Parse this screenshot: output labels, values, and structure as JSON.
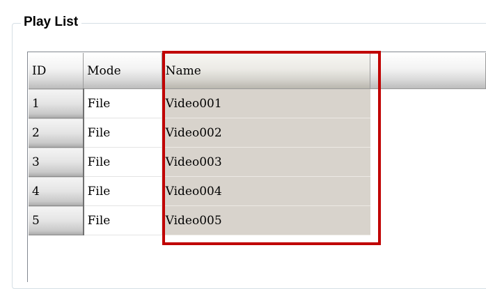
{
  "groupbox": {
    "title": "Play List"
  },
  "table": {
    "columns": {
      "id": "ID",
      "mode": "Mode",
      "name": "Name"
    },
    "rows": [
      {
        "id": "1",
        "mode": "File",
        "name": "Video001"
      },
      {
        "id": "2",
        "mode": "File",
        "name": "Video002"
      },
      {
        "id": "3",
        "mode": "File",
        "name": "Video003"
      },
      {
        "id": "4",
        "mode": "File",
        "name": "Video004"
      },
      {
        "id": "5",
        "mode": "File",
        "name": "Video005"
      }
    ]
  },
  "colors": {
    "highlight_border": "#c00000",
    "name_column_background": "#d8d3cc"
  }
}
